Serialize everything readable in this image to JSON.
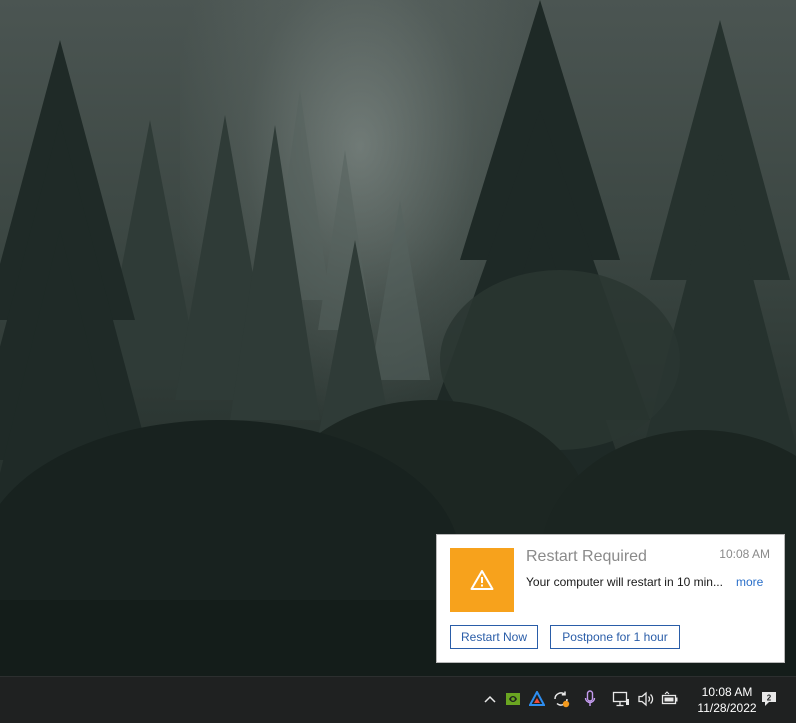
{
  "notification": {
    "title": "Restart Required",
    "time": "10:08 AM",
    "message": "Your computer will restart in 10 min...",
    "more_label": "more",
    "restart_now_label": "Restart Now",
    "postpone_label": "Postpone for 1 hour",
    "icon": "warning-icon",
    "accent_color": "#f7a21c"
  },
  "taskbar": {
    "tray_icons": [
      "chevron-up-icon",
      "nvidia-icon",
      "app-triangle-icon",
      "sync-icon",
      "microphone-icon",
      "network-icon",
      "volume-icon",
      "battery-icon",
      "notification-center-icon"
    ],
    "clock_time": "10:08 AM",
    "clock_date": "11/28/2022",
    "notification_count": "2"
  }
}
